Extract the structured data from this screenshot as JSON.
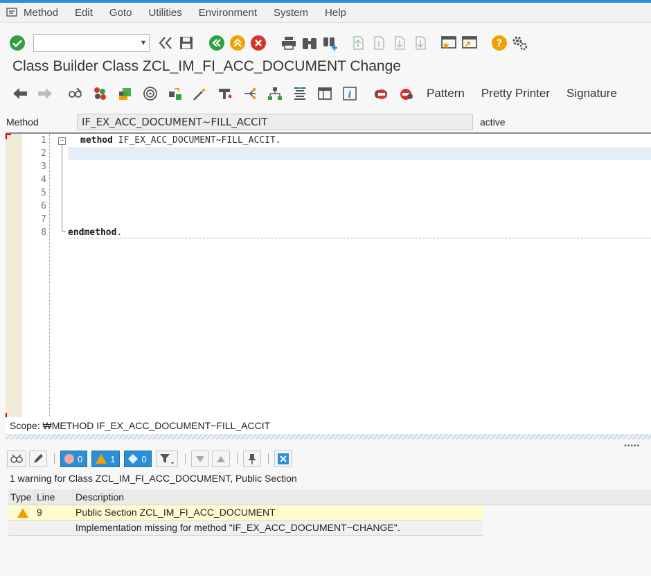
{
  "menu": {
    "items": [
      "Method",
      "Edit",
      "Goto",
      "Utilities",
      "Environment",
      "System",
      "Help"
    ]
  },
  "command_field": {
    "value": ""
  },
  "title": "Class Builder Class ZCL_IM_FI_ACC_DOCUMENT Change",
  "app_toolbar": {
    "pattern_label": "Pattern",
    "pretty_printer_label": "Pretty Printer",
    "signature_label": "Signature"
  },
  "method_row": {
    "label": "Method",
    "value": "IF_EX_ACC_DOCUMENT~FILL_ACCIT",
    "status": "active"
  },
  "editor": {
    "line_numbers": [
      "1",
      "2",
      "3",
      "4",
      "5",
      "6",
      "7",
      "8"
    ],
    "line1_keyword": "method",
    "line1_rest": " IF_EX_ACC_DOCUMENT~FILL_ACCIT.",
    "line8_keyword": "endmethod",
    "line8_rest": "."
  },
  "scope": "Scope: ₩METHOD IF_EX_ACC_DOCUMENT~FILL_ACCIT",
  "messages": {
    "counts": {
      "errors": "0",
      "warnings": "1",
      "info": "0"
    },
    "summary": "1 warning for Class ZCL_IM_FI_ACC_DOCUMENT, Public Section",
    "headers": {
      "type": "Type",
      "line": "Line",
      "description": "Description"
    },
    "rows": [
      {
        "type": "warning-icon",
        "line": "9",
        "description": "Public Section ZCL_IM_FI_ACC_DOCUMENT"
      },
      {
        "type": "",
        "line": "",
        "description": "Implementation missing for method \"IF_EX_ACC_DOCUMENT~CHANGE\"."
      }
    ]
  },
  "colors": {
    "accent_blue": "#2b8fd6",
    "green_check": "#2ea043",
    "warning_orange": "#f0a000",
    "error_red": "#d9342b"
  }
}
